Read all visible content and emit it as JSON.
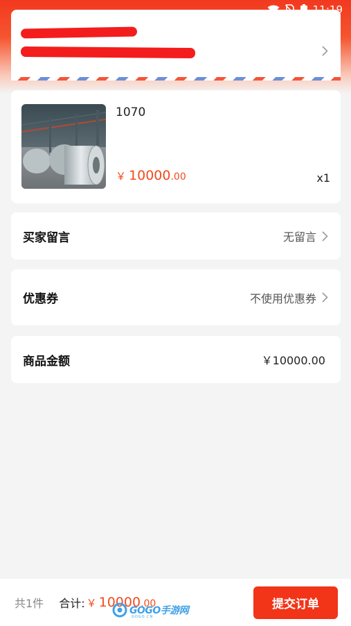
{
  "status_bar": {
    "time": "11:19"
  },
  "address": {
    "redacted": true
  },
  "product": {
    "name": "1070",
    "price_symbol": "￥",
    "price_int": "10000",
    "price_dec": ".00",
    "quantity": "x1"
  },
  "message": {
    "label": "买家留言",
    "value": "无留言"
  },
  "coupon": {
    "label": "优惠券",
    "value": "不使用优惠券"
  },
  "amount": {
    "label": "商品金额",
    "value": "￥10000.00"
  },
  "bottom_bar": {
    "count": "共1件",
    "total_label": "合计:",
    "total_symbol": "￥",
    "total_int": "10000",
    "total_dec": ".00",
    "submit_label": "提交订单"
  },
  "watermark": {
    "text": "GOGO手游网",
    "sub": "GOGO.CN"
  },
  "colors": {
    "accent": "#f23418",
    "price": "#f34a1c"
  }
}
